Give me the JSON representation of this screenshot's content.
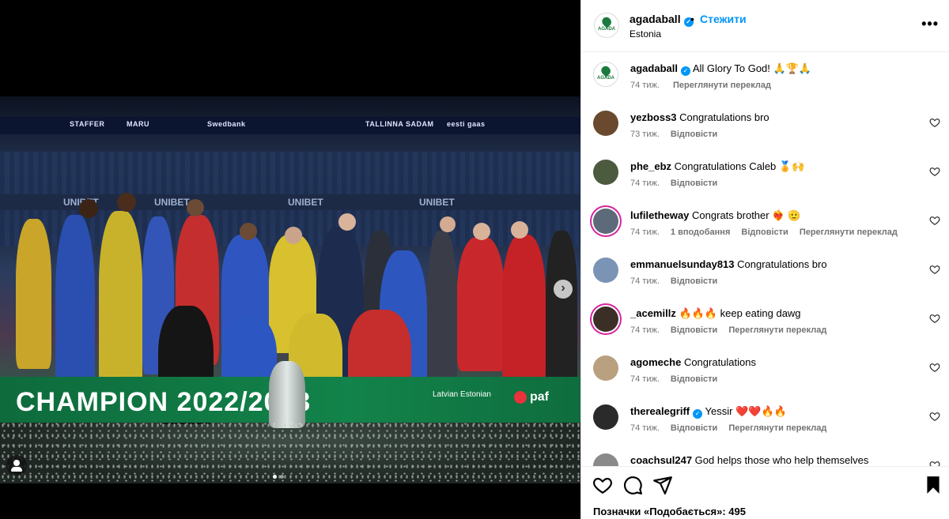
{
  "photo": {
    "sponsors": [
      "STAFFER",
      "MARU",
      "Swedbank",
      "TALLINNA SADAM",
      "eesti gaas"
    ],
    "board_text": "UNIBET",
    "banner_text": "CHAMPION 2022/2023",
    "latvian_estonian": "Latvian Estonian",
    "paf": "paf"
  },
  "post": {
    "username": "agadaball",
    "separator": "•",
    "follow_label": "Стежити",
    "location": "Estonia",
    "more_label": "•••",
    "logo_word": "AGADA"
  },
  "caption": {
    "username": "agadaball",
    "text": "All Glory To God! 🙏🏆🙏",
    "time": "74 тиж.",
    "translate": "Переглянути переклад"
  },
  "comments": [
    {
      "username": "yezboss3",
      "text": "Congratulations bro",
      "time": "73 тиж.",
      "likes": "",
      "reply": "Відповісти",
      "translate": "",
      "avatar_color": "#6a4a2e",
      "ring": false
    },
    {
      "username": "phe_ebz",
      "text": "Congratulations Caleb 🏅🙌",
      "time": "74 тиж.",
      "likes": "",
      "reply": "Відповісти",
      "translate": "",
      "avatar_color": "#4c5a3e",
      "ring": false
    },
    {
      "username": "lufiletheway",
      "text": "Congrats brother ❤️‍🔥 🫡",
      "time": "74 тиж.",
      "likes": "1 вподобання",
      "reply": "Відповісти",
      "translate": "Переглянути переклад",
      "avatar_color": "#5d6a7a",
      "ring": true
    },
    {
      "username": "emmanuelsunday813",
      "text": "Congratulations bro",
      "time": "74 тиж.",
      "likes": "",
      "reply": "Відповісти",
      "translate": "",
      "avatar_color": "#7b93b5",
      "ring": false
    },
    {
      "username": "_acemillz",
      "text": "🔥🔥🔥 keep eating dawg",
      "time": "74 тиж.",
      "likes": "",
      "reply": "Відповісти",
      "translate": "Переглянути переклад",
      "avatar_color": "#3a2e26",
      "ring": true
    },
    {
      "username": "agomeche",
      "text": "Congratulations",
      "time": "74 тиж.",
      "likes": "",
      "reply": "Відповісти",
      "translate": "",
      "avatar_color": "#b9a07e",
      "ring": false
    },
    {
      "username": "therealegriff",
      "verified": true,
      "text": "Yessir ❤️❤️🔥🔥",
      "time": "74 тиж.",
      "likes": "",
      "reply": "Відповісти",
      "translate": "Переглянути переклад",
      "avatar_color": "#2a2a2a",
      "ring": false
    },
    {
      "username": "coachsul247",
      "text": "God helps those who help themselves",
      "time": "",
      "likes": "",
      "reply": "",
      "translate": "",
      "avatar_color": "#8a8a8a",
      "ring": false
    }
  ],
  "footer": {
    "likes_label": "Позначки «Подобається»: 495"
  },
  "colors": {
    "accent": "#0095f6",
    "meta": "#737373",
    "divider": "#efefef"
  }
}
